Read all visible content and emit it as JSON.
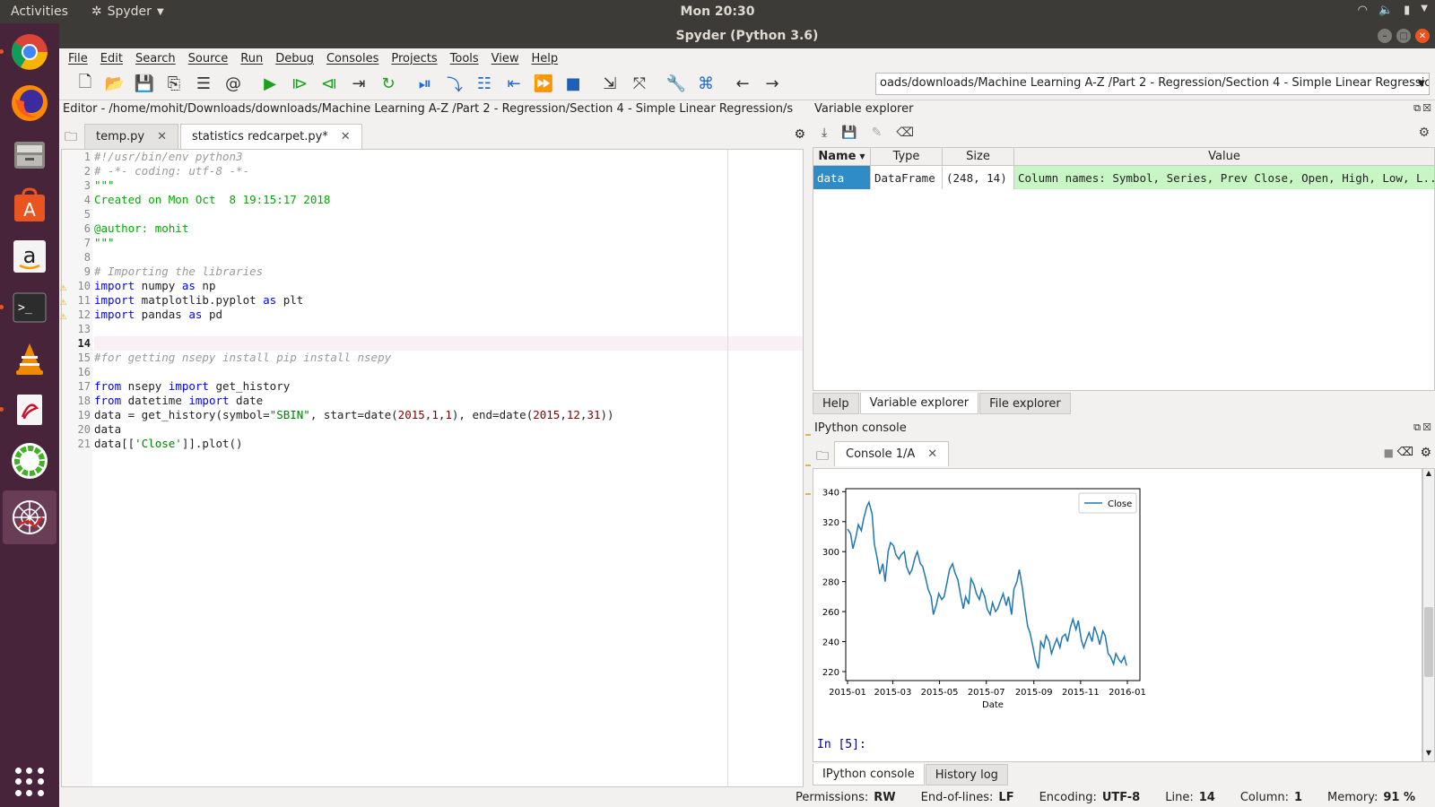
{
  "topbar": {
    "activities": "Activities",
    "app": "Spyder",
    "clock": "Mon 20:30"
  },
  "window": {
    "title": "Spyder (Python 3.6)"
  },
  "menu": [
    "File",
    "Edit",
    "Search",
    "Source",
    "Run",
    "Debug",
    "Consoles",
    "Projects",
    "Tools",
    "View",
    "Help"
  ],
  "toolbar": {
    "path": "oads/downloads/Machine Learning A-Z /Part 2 - Regression/Section 4 - Simple Linear Regression"
  },
  "editor": {
    "header": "Editor - /home/mohit/Downloads/downloads/Machine Learning A-Z /Part 2 - Regression/Section 4 - Simple Linear Regression/statist...",
    "tabs": [
      {
        "label": "temp.py"
      },
      {
        "label": "statistics redcarpet.py*"
      }
    ],
    "line_numbers": [
      "1",
      "2",
      "3",
      "4",
      "5",
      "6",
      "7",
      "8",
      "9",
      "10",
      "11",
      "12",
      "13",
      "14",
      "15",
      "16",
      "17",
      "18",
      "19",
      "20",
      "21"
    ],
    "lines": {
      "l1": "#!/usr/bin/env python3",
      "l2": "# -*- coding: utf-8 -*-",
      "l3": "\"\"\"",
      "l4": "Created on Mon Oct  8 19:15:17 2018",
      "l6": "@author: mohit",
      "l7": "\"\"\"",
      "l9": "# Importing the libraries",
      "kw_import": "import",
      "kw_as": "as",
      "kw_from": "from",
      "l10_mod": " numpy ",
      "l10_alias": " np",
      "l11_mod": " matplotlib.pyplot ",
      "l11_alias": " plt",
      "l12_mod": " pandas ",
      "l12_alias": " pd",
      "l15": "#for getting nsepy install pip install nsepy",
      "l17_mod": " nsepy ",
      "l17_name": " get_history",
      "l18_mod": " datetime ",
      "l18_name": " date",
      "l19_a": "data = get_history(symbol=",
      "l19_sym": "\"SBIN\"",
      "l19_b": ", start=date(",
      "n2015": "2015",
      "n1": "1",
      "n12": "12",
      "n31": "31",
      "comma": ",",
      "l19_c": "), end=date(",
      "l19_d": "))",
      "l20": "data",
      "l21_a": "data[[",
      "l21_s": "'Close'",
      "l21_b": "]].plot()"
    }
  },
  "variable_explorer": {
    "title": "Variable explorer",
    "columns": [
      "Name",
      "Type",
      "Size",
      "Value"
    ],
    "rows": [
      {
        "name": "data",
        "type": "DataFrame",
        "size": "(248, 14)",
        "value": "Column names: Symbol, Series, Prev Close, Open, High, Low, L..."
      }
    ],
    "tabs": [
      "Help",
      "Variable explorer",
      "File explorer"
    ]
  },
  "console": {
    "title": "IPython console",
    "tab": "Console 1/A",
    "prompt": "In [5]:",
    "bottom_tabs": [
      "IPython console",
      "History log"
    ]
  },
  "status": {
    "permissions_label": "Permissions:",
    "permissions": "RW",
    "eol_label": "End-of-lines:",
    "eol": "LF",
    "encoding_label": "Encoding:",
    "encoding": "UTF-8",
    "line_label": "Line:",
    "line": "14",
    "column_label": "Column:",
    "column": "1",
    "memory_label": "Memory:",
    "memory": "91 %"
  },
  "chart_data": {
    "type": "line",
    "xlabel": "Date",
    "x_ticks": [
      "2015-01",
      "2015-03",
      "2015-05",
      "2015-07",
      "2015-09",
      "2015-11",
      "2016-01"
    ],
    "y_ticks": [
      220,
      240,
      260,
      280,
      300,
      320,
      340
    ],
    "ylim": [
      214,
      342
    ],
    "legend": {
      "position": "top-right"
    },
    "series": [
      {
        "name": "Close",
        "color": "#1f77b4",
        "x": [
          "2015-01-01",
          "2015-01-05",
          "2015-01-08",
          "2015-01-12",
          "2015-01-15",
          "2015-01-19",
          "2015-01-22",
          "2015-01-26",
          "2015-01-29",
          "2015-02-02",
          "2015-02-05",
          "2015-02-09",
          "2015-02-12",
          "2015-02-16",
          "2015-02-19",
          "2015-02-23",
          "2015-02-26",
          "2015-03-02",
          "2015-03-05",
          "2015-03-09",
          "2015-03-12",
          "2015-03-16",
          "2015-03-19",
          "2015-03-23",
          "2015-03-26",
          "2015-03-30",
          "2015-04-02",
          "2015-04-06",
          "2015-04-09",
          "2015-04-13",
          "2015-04-16",
          "2015-04-20",
          "2015-04-23",
          "2015-04-27",
          "2015-04-30",
          "2015-05-04",
          "2015-05-07",
          "2015-05-11",
          "2015-05-14",
          "2015-05-18",
          "2015-05-21",
          "2015-05-25",
          "2015-05-28",
          "2015-06-01",
          "2015-06-04",
          "2015-06-08",
          "2015-06-11",
          "2015-06-15",
          "2015-06-18",
          "2015-06-22",
          "2015-06-25",
          "2015-06-29",
          "2015-07-02",
          "2015-07-06",
          "2015-07-09",
          "2015-07-13",
          "2015-07-16",
          "2015-07-20",
          "2015-07-23",
          "2015-07-27",
          "2015-07-30",
          "2015-08-03",
          "2015-08-06",
          "2015-08-10",
          "2015-08-13",
          "2015-08-17",
          "2015-08-20",
          "2015-08-24",
          "2015-08-27",
          "2015-08-31",
          "2015-09-03",
          "2015-09-07",
          "2015-09-10",
          "2015-09-14",
          "2015-09-17",
          "2015-09-21",
          "2015-09-24",
          "2015-09-28",
          "2015-10-01",
          "2015-10-05",
          "2015-10-08",
          "2015-10-12",
          "2015-10-15",
          "2015-10-19",
          "2015-10-22",
          "2015-10-26",
          "2015-10-29",
          "2015-11-02",
          "2015-11-05",
          "2015-11-09",
          "2015-11-12",
          "2015-11-16",
          "2015-11-19",
          "2015-11-23",
          "2015-11-26",
          "2015-11-30",
          "2015-12-03",
          "2015-12-07",
          "2015-12-10",
          "2015-12-14",
          "2015-12-17",
          "2015-12-21",
          "2015-12-24",
          "2015-12-28",
          "2015-12-31"
        ],
        "values": [
          315,
          312,
          302,
          310,
          318,
          314,
          322,
          330,
          333,
          325,
          305,
          295,
          285,
          292,
          280,
          300,
          306,
          304,
          298,
          295,
          298,
          300,
          290,
          285,
          288,
          296,
          300,
          292,
          290,
          282,
          275,
          270,
          258,
          265,
          272,
          268,
          270,
          280,
          288,
          292,
          286,
          281,
          272,
          262,
          270,
          265,
          282,
          278,
          272,
          268,
          275,
          270,
          262,
          258,
          266,
          260,
          262,
          268,
          272,
          264,
          270,
          258,
          275,
          280,
          288,
          276,
          264,
          250,
          246,
          236,
          228,
          222,
          240,
          236,
          244,
          240,
          232,
          238,
          242,
          236,
          243,
          245,
          240,
          250,
          255,
          248,
          254,
          241,
          236,
          242,
          246,
          240,
          250,
          244,
          238,
          247,
          244,
          232,
          230,
          225,
          232,
          228,
          226,
          230,
          224
        ]
      }
    ]
  }
}
